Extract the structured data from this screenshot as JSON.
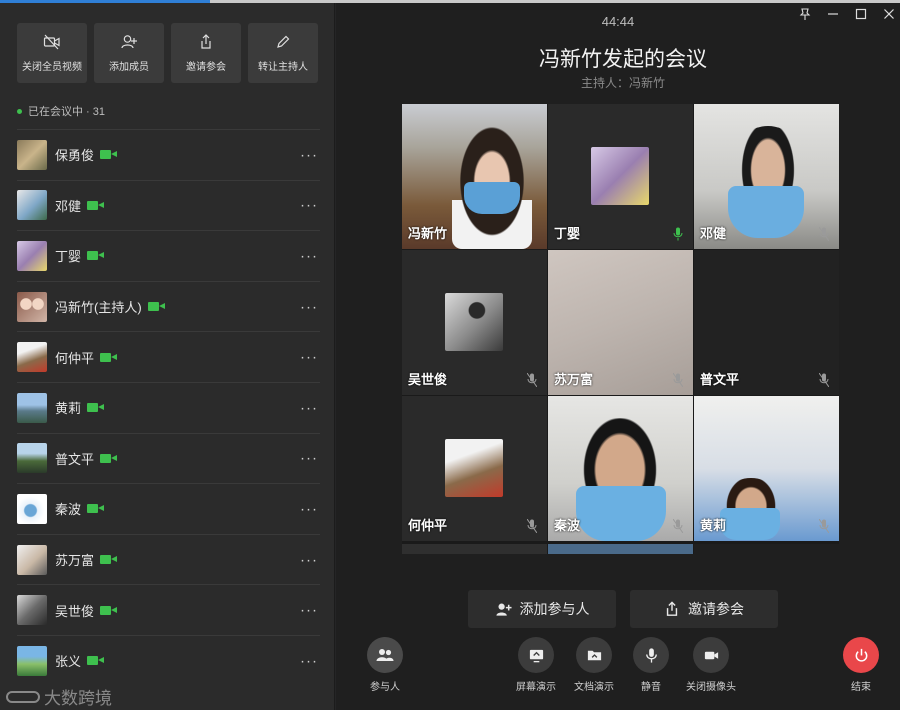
{
  "toolbar": {
    "buttons": [
      {
        "label": "关闭全员视频",
        "icon": "video-off-icon"
      },
      {
        "label": "添加成员",
        "icon": "add-user-icon"
      },
      {
        "label": "邀请参会",
        "icon": "share-icon"
      },
      {
        "label": "转让主持人",
        "icon": "pen-icon"
      }
    ]
  },
  "status": "已在会议中 · 31",
  "participants": [
    {
      "name": "保勇俊"
    },
    {
      "name": "邓健"
    },
    {
      "name": "丁婴"
    },
    {
      "name": "冯新竹(主持人)"
    },
    {
      "name": "何仲平"
    },
    {
      "name": "黄莉"
    },
    {
      "name": "普文平"
    },
    {
      "name": "秦波"
    },
    {
      "name": "苏万富"
    },
    {
      "name": "吴世俊"
    },
    {
      "name": "张义"
    }
  ],
  "meeting": {
    "timer": "44:44",
    "title": "冯新竹发起的会议",
    "host": "主持人：冯新竹"
  },
  "tiles": [
    {
      "name": "冯新竹"
    },
    {
      "name": "丁婴"
    },
    {
      "name": "邓健"
    },
    {
      "name": "吴世俊"
    },
    {
      "name": "苏万富"
    },
    {
      "name": "普文平"
    },
    {
      "name": "何仲平"
    },
    {
      "name": "秦波"
    },
    {
      "name": "黄莉"
    }
  ],
  "actions": {
    "add_participant": "添加参与人",
    "invite": "邀请参会"
  },
  "bottom": {
    "participants": "参与人",
    "screen_share": "屏幕演示",
    "doc_share": "文档演示",
    "mute": "静音",
    "camera_off": "关闭摄像头",
    "end": "结束"
  },
  "watermark": "大数跨境",
  "colors": {
    "accent_green": "#3ec04e",
    "end_red": "#e9474a",
    "background": "#1f1f1f"
  }
}
